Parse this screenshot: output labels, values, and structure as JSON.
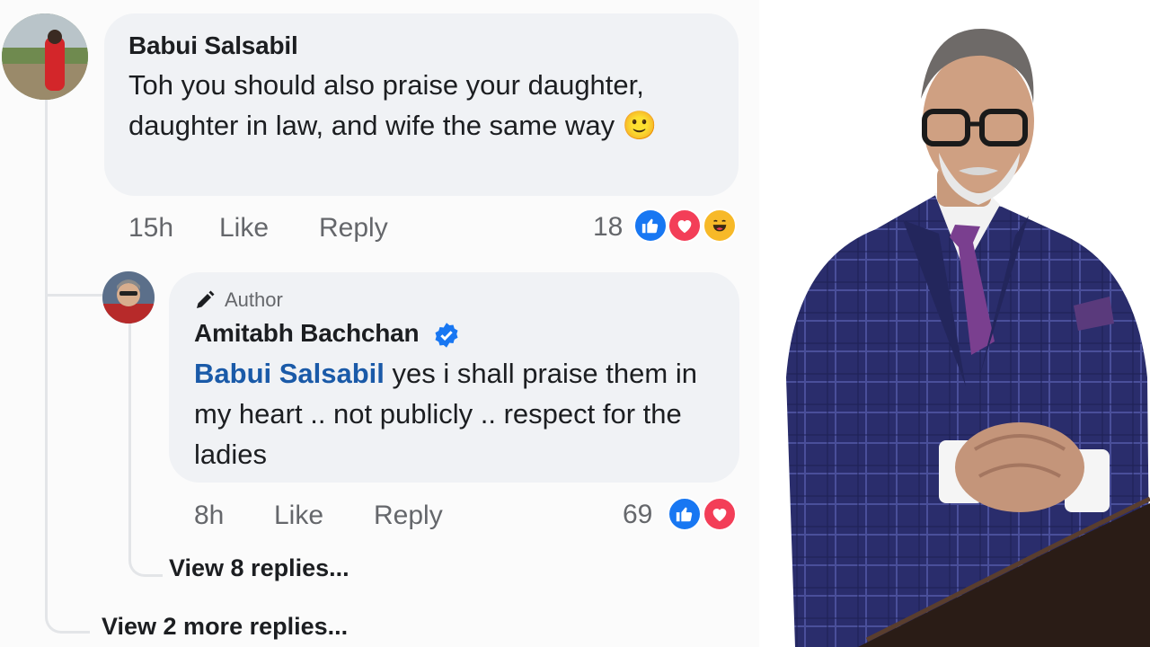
{
  "comment1": {
    "author": "Babui Salsabil",
    "text": "Toh you should also praise your daughter, daughter in law, and wife the same way",
    "emoji": "🙂",
    "time": "15h",
    "like_label": "Like",
    "reply_label": "Reply",
    "reaction_count": "18",
    "reactions": [
      "like-icon",
      "love-icon",
      "haha-icon"
    ]
  },
  "reply1": {
    "badge": "Author",
    "author": "Amitabh Bachchan",
    "verified": true,
    "mention": "Babui Salsabil",
    "text": " yes i shall praise them in my heart .. not publicly .. respect for the ladies",
    "time": "8h",
    "like_label": "Like",
    "reply_label": "Reply",
    "reaction_count": "69",
    "reactions": [
      "like-icon",
      "love-icon"
    ],
    "view_replies": "View 8 replies..."
  },
  "view_more_replies": "View 2 more replies...",
  "colors": {
    "bubble": "#f0f2f5",
    "mention": "#1a5aa8",
    "like": "#1877f2",
    "love": "#f33e58",
    "haha": "#f7b928",
    "suit": "#2b2f6e"
  }
}
